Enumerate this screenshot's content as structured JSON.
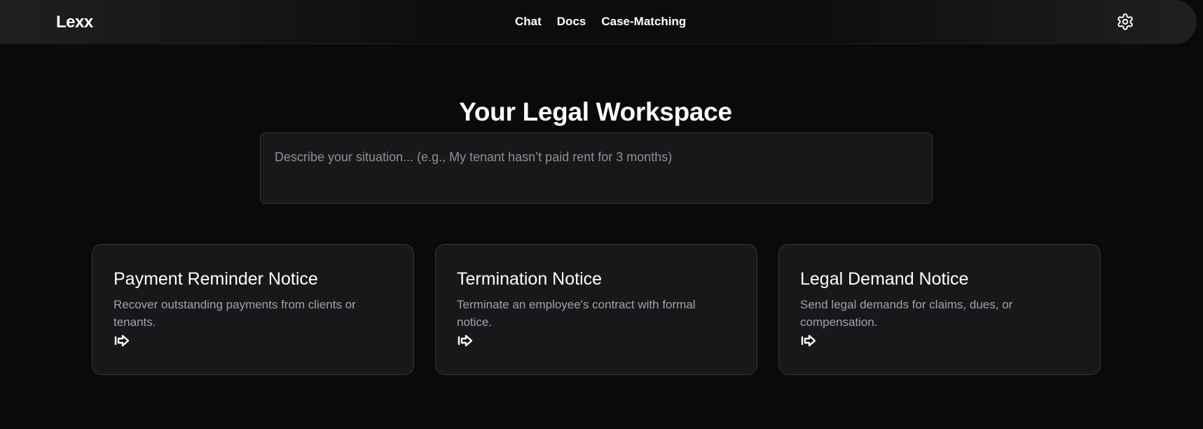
{
  "header": {
    "brand": "Lexx",
    "nav": [
      {
        "label": "Chat"
      },
      {
        "label": "Docs"
      },
      {
        "label": "Case-Matching"
      }
    ],
    "settings_icon": "gear-icon"
  },
  "main": {
    "title": "Your Legal Workspace",
    "situation_input": {
      "placeholder": "Describe your situation... (e.g., My tenant hasn’t paid rent for 3 months)",
      "value": ""
    },
    "cards": [
      {
        "title": "Payment Reminder Notice",
        "description": "Recover outstanding payments from clients or tenants.",
        "icon": "arrow-right-icon"
      },
      {
        "title": "Termination Notice",
        "description": "Terminate an employee's contract with formal notice.",
        "icon": "arrow-right-icon"
      },
      {
        "title": "Legal Demand Notice",
        "description": "Send legal demands for claims, dues, or compensation.",
        "icon": "arrow-right-icon"
      }
    ]
  },
  "colors": {
    "background": "#0a0a0c",
    "card_background": "#18181b",
    "border": "#34343a",
    "muted_text": "#a1a1aa",
    "text": "#ffffff"
  }
}
